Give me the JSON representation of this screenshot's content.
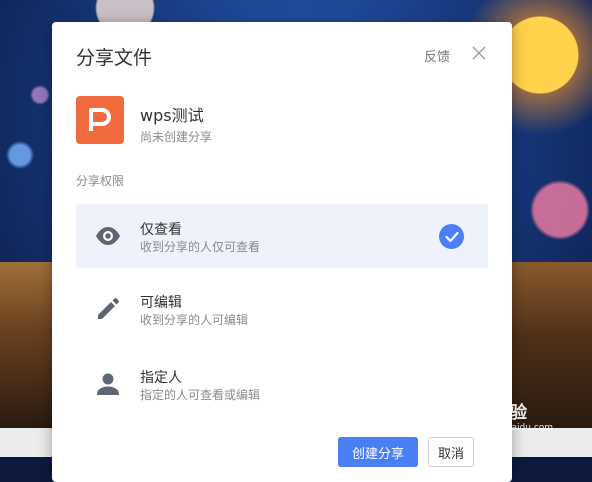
{
  "dialog": {
    "title": "分享文件",
    "feedback_label": "反馈",
    "close_icon": "close-icon"
  },
  "file": {
    "icon": "wps-presentation-icon",
    "icon_letter": "P",
    "icon_color": "#f06a3e",
    "name": "wps测试",
    "status": "尚未创建分享"
  },
  "permissions": {
    "label": "分享权限",
    "options": [
      {
        "icon": "eye-icon",
        "title": "仅查看",
        "desc": "收到分享的人仅可查看",
        "selected": true
      },
      {
        "icon": "pencil-icon",
        "title": "可编辑",
        "desc": "收到分享的人可编辑",
        "selected": false
      },
      {
        "icon": "person-icon",
        "title": "指定人",
        "desc": "指定的人可查看或编辑",
        "selected": false
      }
    ]
  },
  "buttons": {
    "create_label": "创建分享",
    "cancel_label": "取消"
  },
  "colors": {
    "accent": "#4a7ff5",
    "selected_bg": "#eef2fb"
  },
  "watermark": {
    "text": "Bai 经验",
    "subtext": "jingyan.baidu.com"
  }
}
